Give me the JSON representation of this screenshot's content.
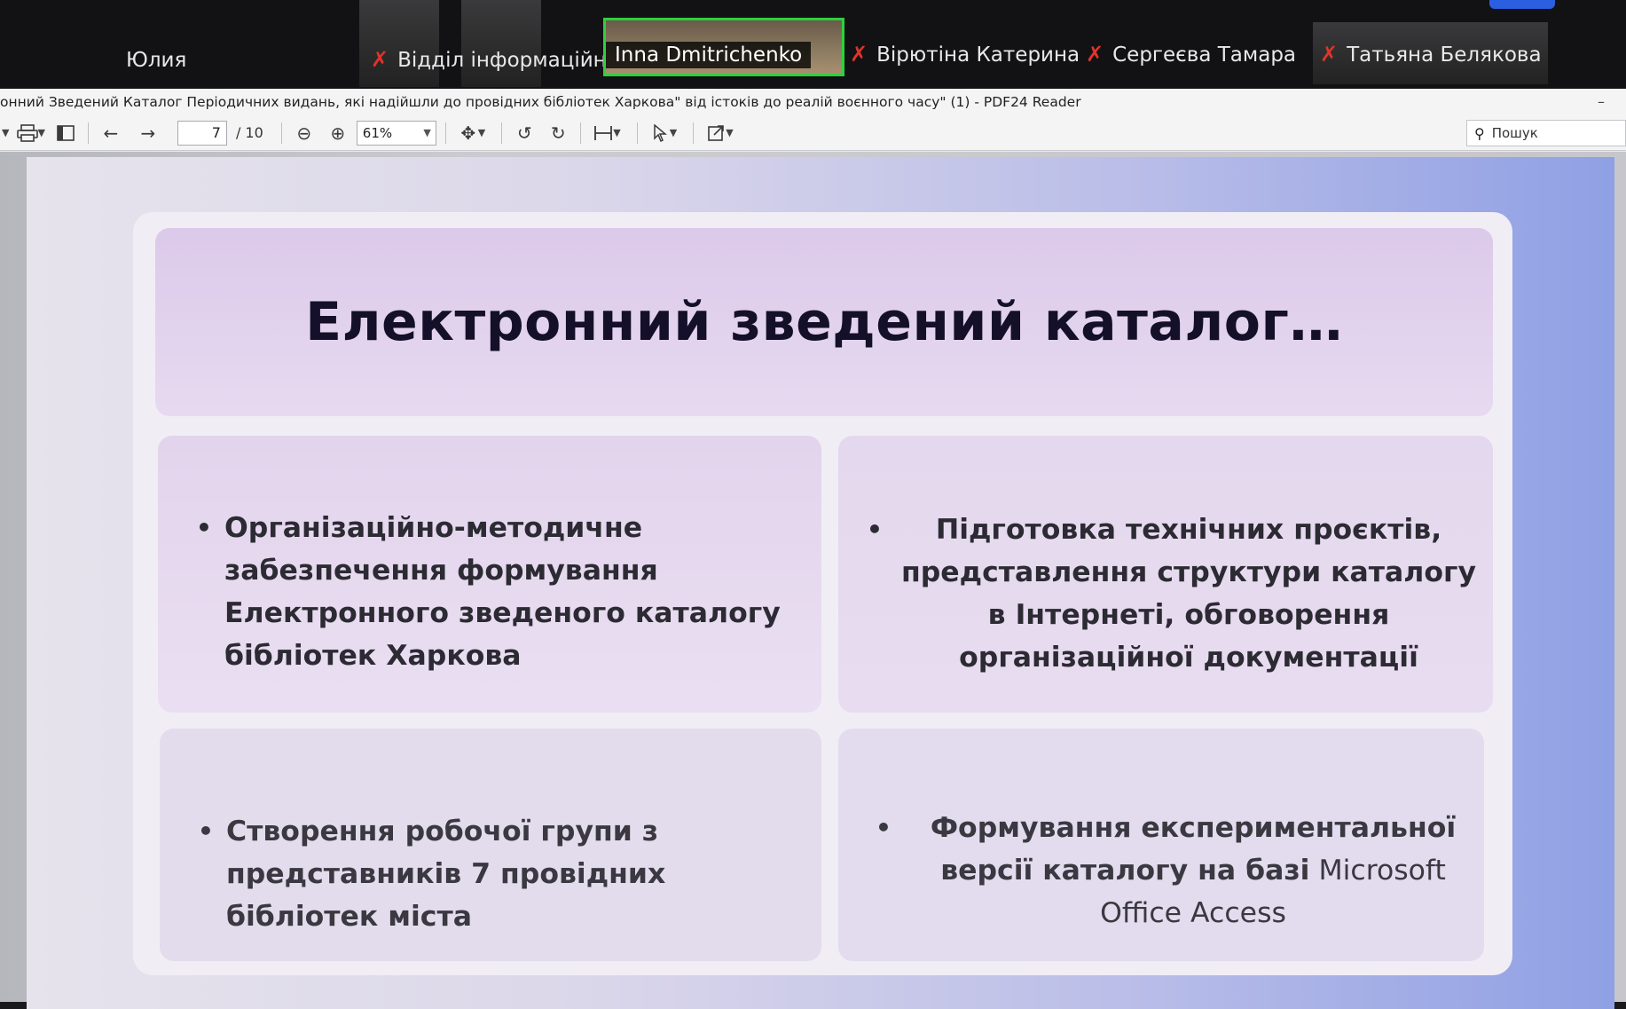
{
  "participants": [
    {
      "name": "Юлия",
      "muted": false
    },
    {
      "name": "Відділ інформаційно-...",
      "muted": true
    },
    {
      "name": "Inna Dmitrichenko",
      "muted": false,
      "active": true
    },
    {
      "name": "Вірютіна Катерина",
      "muted": true
    },
    {
      "name": "Сергеєва Тамара",
      "muted": true
    },
    {
      "name": "Татьяна Белякова",
      "muted": true
    }
  ],
  "colors": {
    "active_speaker_border": "#2fd13c",
    "muted_icon": "#e0342b",
    "slide_title": "#15102a"
  },
  "icons": {
    "muted": "microphone-off-icon"
  },
  "window": {
    "title": "онний Зведений Каталог Періодичних видань, які надійшли до провідних бібліотек Харкова\" від істоків до реалій воєнного часу\" (1) - PDF24 Reader",
    "minimize": "–"
  },
  "toolbar": {
    "current_page": "7",
    "total_pages": "/ 10",
    "zoom": "61%",
    "search_placeholder": "Пошук"
  },
  "slide": {
    "title": "Електронний зведений каталог…",
    "cards": [
      {
        "text": "Організаційно-методичне забезпечення формування Електронного зведеного каталогу бібліотек Харкова"
      },
      {
        "text": "Підготовка технічних проєктів, представлення структури каталогу в Інтернеті, обговорення організаційної документації"
      },
      {
        "text": "Створення робочої групи з представників 7 провідних бібліотек міста"
      },
      {
        "text_bold": "Формування експериментальної версії каталогу на базі",
        "text_light": " Microsoft Office Access"
      }
    ]
  }
}
